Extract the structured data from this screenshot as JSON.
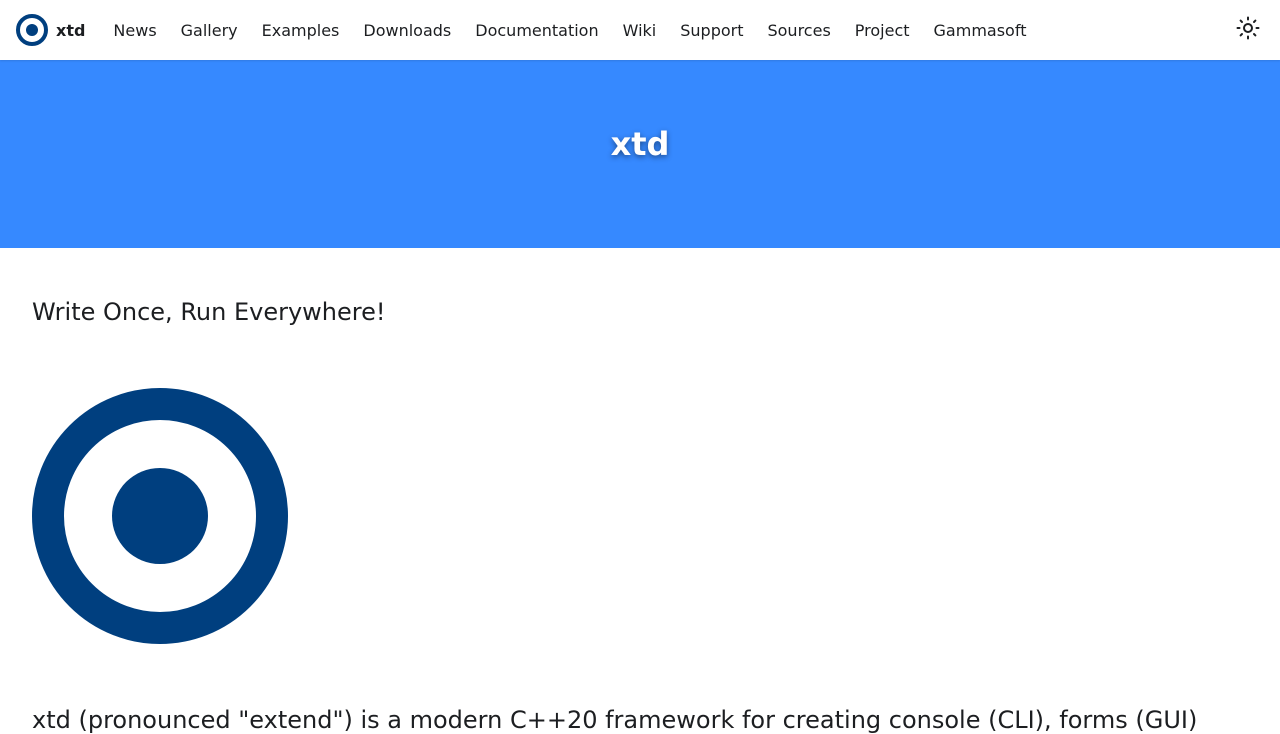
{
  "navbar": {
    "brand_title": "xtd",
    "items": [
      {
        "label": "News"
      },
      {
        "label": "Gallery"
      },
      {
        "label": "Examples"
      },
      {
        "label": "Downloads"
      },
      {
        "label": "Documentation"
      },
      {
        "label": "Wiki"
      },
      {
        "label": "Support"
      },
      {
        "label": "Sources"
      },
      {
        "label": "Project"
      },
      {
        "label": "Gammasoft"
      }
    ],
    "theme_toggle_icon": "sun-icon"
  },
  "hero": {
    "title": "xtd"
  },
  "main": {
    "tagline": "Write Once, Run Everywhere!",
    "logo_icon": "xtd-logo-icon",
    "intro": "xtd (pronounced \"extend\") is a modern C++20 framework for creating console (CLI), forms (GUI)"
  },
  "colors": {
    "brand_dark_blue": "#003f7f",
    "hero_blue": "#3689ff",
    "text": "#1c1e21",
    "background": "#ffffff"
  }
}
